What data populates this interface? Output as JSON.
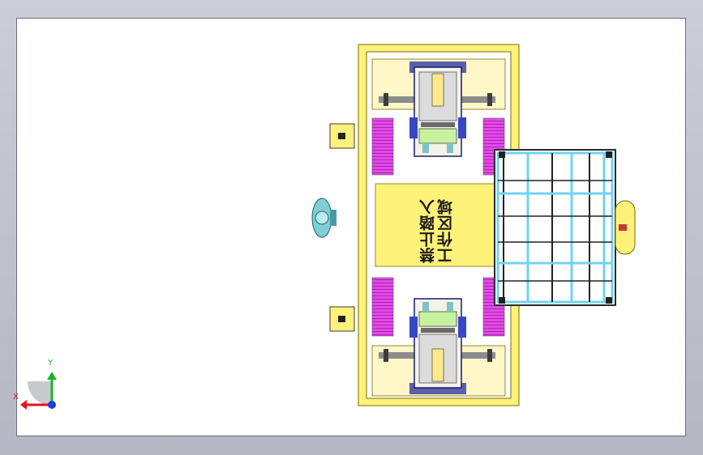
{
  "drawing": {
    "zone_label_line1": "工作区域",
    "zone_label_line2": "禁止踏入",
    "axis_y_label": "Y",
    "axis_x_label": "X"
  },
  "colors": {
    "frame_yellow": "#fff27a",
    "frame_border": "#7a6b00",
    "pad_cream": "#fff7c8",
    "magenta": "#e24be6",
    "steel_blue": "#5a5fa8",
    "light_green": "#c7f2a0",
    "cyan_frame": "#6fd4f0",
    "axis_green": "#17b52b",
    "axis_red": "#e0141c",
    "axis_blue": "#1f3fd6"
  }
}
